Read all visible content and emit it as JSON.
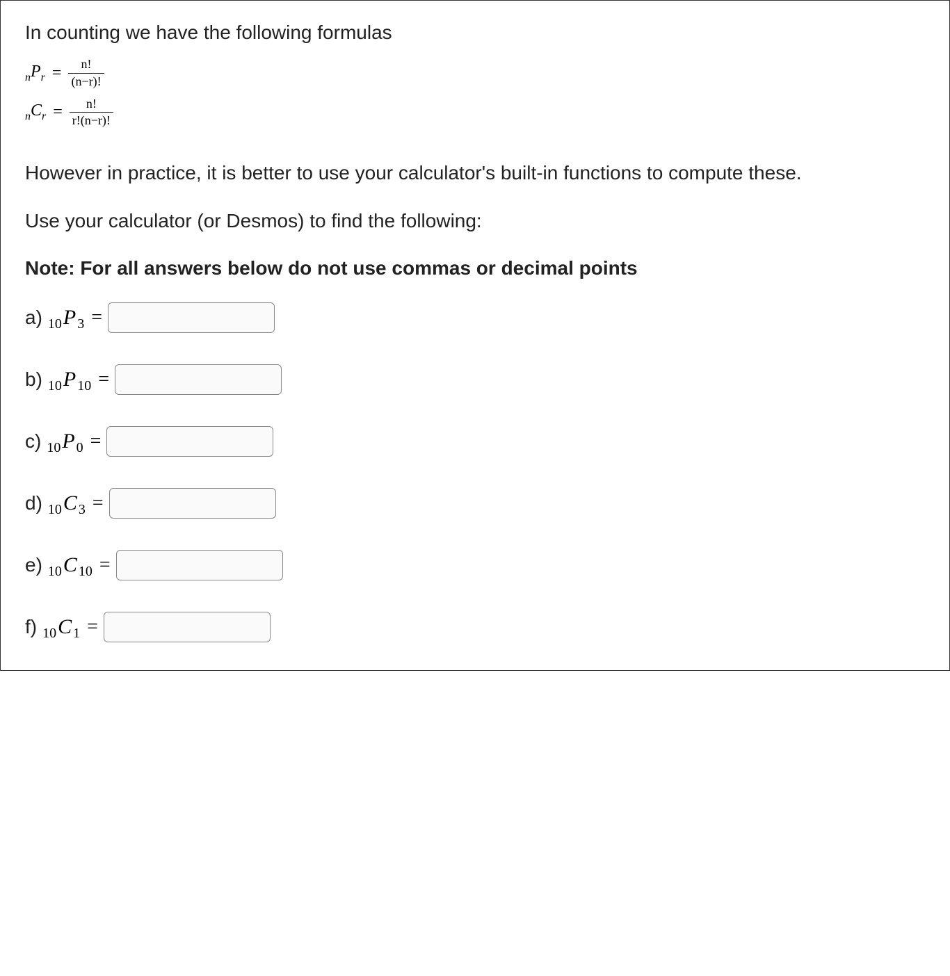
{
  "intro": "In counting we have the following formulas",
  "formulas": {
    "perm": {
      "lhs_n": "n",
      "lhs_sym": "P",
      "lhs_r": "r",
      "eq": "=",
      "num": "n!",
      "den": "(n−r)!"
    },
    "comb": {
      "lhs_n": "n",
      "lhs_sym": "C",
      "lhs_r": "r",
      "eq": "=",
      "num": "n!",
      "den": "r!(n−r)!"
    }
  },
  "paragraph1": "However in practice, it is better to use your calculator's built-in functions to compute these.",
  "paragraph2": "Use your calculator (or Desmos) to find the following:",
  "note": "Note:  For all answers below do not use commas or decimal points",
  "questions": {
    "a": {
      "label": "a)",
      "n": "10",
      "sym": "P",
      "r": "3",
      "eq": "=",
      "value": ""
    },
    "b": {
      "label": "b)",
      "n": "10",
      "sym": "P",
      "r": "10",
      "eq": "=",
      "value": ""
    },
    "c": {
      "label": "c)",
      "n": "10",
      "sym": "P",
      "r": "0",
      "eq": "=",
      "value": ""
    },
    "d": {
      "label": "d)",
      "n": "10",
      "sym": "C",
      "r": "3",
      "eq": "=",
      "value": ""
    },
    "e": {
      "label": "e)",
      "n": "10",
      "sym": "C",
      "r": "10",
      "eq": "=",
      "value": ""
    },
    "f": {
      "label": "f)",
      "n": "10",
      "sym": "C",
      "r": "1",
      "eq": "=",
      "value": ""
    }
  }
}
